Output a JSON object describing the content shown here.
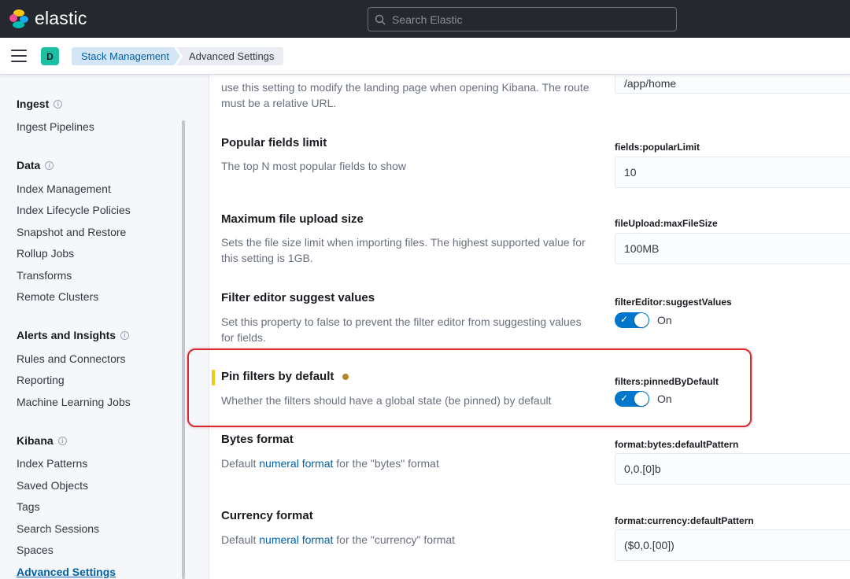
{
  "header": {
    "brand": "elastic",
    "search_placeholder": "Search Elastic"
  },
  "subheader": {
    "space_initial": "D",
    "breadcrumbs": [
      "Stack Management",
      "Advanced Settings"
    ]
  },
  "sidebar": {
    "sections": [
      {
        "title": "Ingest",
        "items": [
          "Ingest Pipelines"
        ]
      },
      {
        "title": "Data",
        "items": [
          "Index Management",
          "Index Lifecycle Policies",
          "Snapshot and Restore",
          "Rollup Jobs",
          "Transforms",
          "Remote Clusters"
        ]
      },
      {
        "title": "Alerts and Insights",
        "items": [
          "Rules and Connectors",
          "Reporting",
          "Machine Learning Jobs"
        ]
      },
      {
        "title": "Kibana",
        "items": [
          "Index Patterns",
          "Saved Objects",
          "Tags",
          "Search Sessions",
          "Spaces",
          "Advanced Settings"
        ]
      }
    ]
  },
  "settings": {
    "default_route": {
      "desc_partial": "use this setting to modify the landing page when opening Kibana. The route must be a relative URL.",
      "value": "/app/home"
    },
    "popular_limit": {
      "title": "Popular fields limit",
      "desc": "The top N most popular fields to show",
      "key": "fields:popularLimit",
      "value": "10"
    },
    "max_file_size": {
      "title": "Maximum file upload size",
      "desc": "Sets the file size limit when importing files. The highest supported value for this setting is 1GB.",
      "key": "fileUpload:maxFileSize",
      "value": "100MB"
    },
    "suggest_values": {
      "title": "Filter editor suggest values",
      "desc": "Set this property to false to prevent the filter editor from suggesting values for fields.",
      "key": "filterEditor:suggestValues",
      "state": "On"
    },
    "pinned_default": {
      "title": "Pin filters by default",
      "desc": "Whether the filters should have a global state (be pinned) by default",
      "key": "filters:pinnedByDefault",
      "state": "On"
    },
    "bytes_format": {
      "title": "Bytes format",
      "desc_prefix": "Default",
      "link": "numeral format",
      "desc_suffix": "for the \"bytes\" format",
      "key": "format:bytes:defaultPattern",
      "value": "0,0.[0]b"
    },
    "currency_format": {
      "title": "Currency format",
      "desc_prefix": "Default",
      "link": "numeral format",
      "desc_suffix": "for the \"currency\" format",
      "key": "format:currency:defaultPattern",
      "value": "($0,0.[00])"
    }
  },
  "colors": {
    "header_bg": "#25282f",
    "accent": "#0077cc",
    "link": "#0061a6",
    "highlight_border": "#d9282f",
    "unsaved_marker": "#f5c71a"
  }
}
